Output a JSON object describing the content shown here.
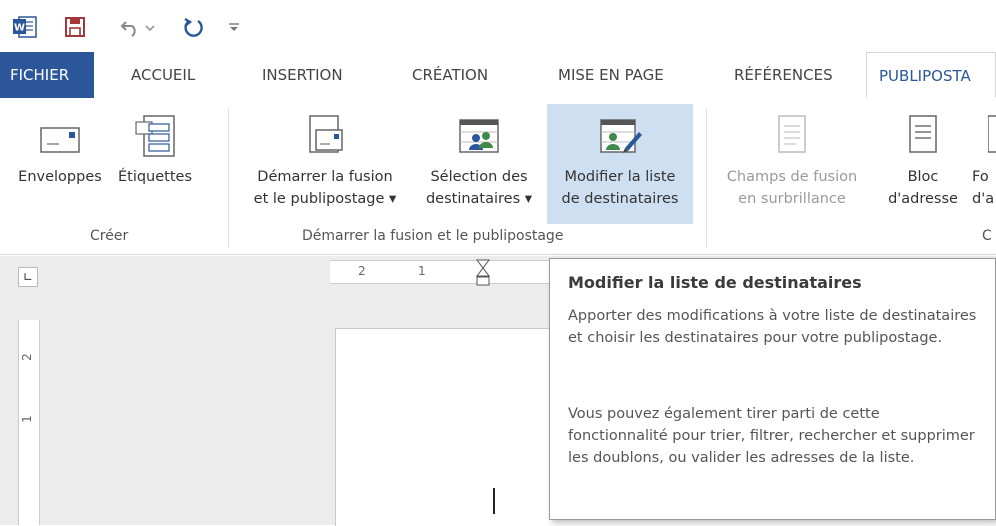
{
  "quick_access": {
    "icons": [
      "word-app-icon",
      "save-icon",
      "undo-icon",
      "redo-icon",
      "customize-qat-icon"
    ]
  },
  "tabs": [
    {
      "label": "FICHIER"
    },
    {
      "label": "ACCUEIL"
    },
    {
      "label": "INSERTION"
    },
    {
      "label": "CRÉATION"
    },
    {
      "label": "MISE EN PAGE"
    },
    {
      "label": "RÉFÉRENCES"
    },
    {
      "label": "PUBLIPOSTA"
    }
  ],
  "ribbon": {
    "groups": [
      {
        "label": "Créer"
      },
      {
        "label": "Démarrer la fusion et le publipostage"
      },
      {
        "label": "C"
      }
    ],
    "buttons": [
      {
        "line1": "Enveloppes",
        "line2": ""
      },
      {
        "line1": "Étiquettes",
        "line2": ""
      },
      {
        "line1": "Démarrer la fusion",
        "line2": "et le publipostage ▾"
      },
      {
        "line1": "Sélection des",
        "line2": "destinataires ▾"
      },
      {
        "line1": "Modifier la liste",
        "line2": "de destinataires"
      },
      {
        "line1": "Champs de fusion",
        "line2": "en surbrillance"
      },
      {
        "line1": "Bloc",
        "line2": "d'adresse"
      },
      {
        "line1": "Fo",
        "line2": "d'a"
      }
    ]
  },
  "ruler": {
    "h_ticks": [
      "2",
      "1"
    ],
    "v_ticks": [
      "2",
      "1"
    ]
  },
  "tooltip": {
    "title": "Modifier la liste de destinataires",
    "para1": "Apporter des modifications à votre liste de destinataires et choisir les destinataires pour votre publipostage.",
    "para2": "Vous pouvez également tirer parti de cette fonctionnalité pour trier, filtrer, rechercher et supprimer les doublons, ou valider les adresses de la liste."
  },
  "colors": {
    "accent": "#2b579a",
    "highlight": "#cfdff2"
  }
}
